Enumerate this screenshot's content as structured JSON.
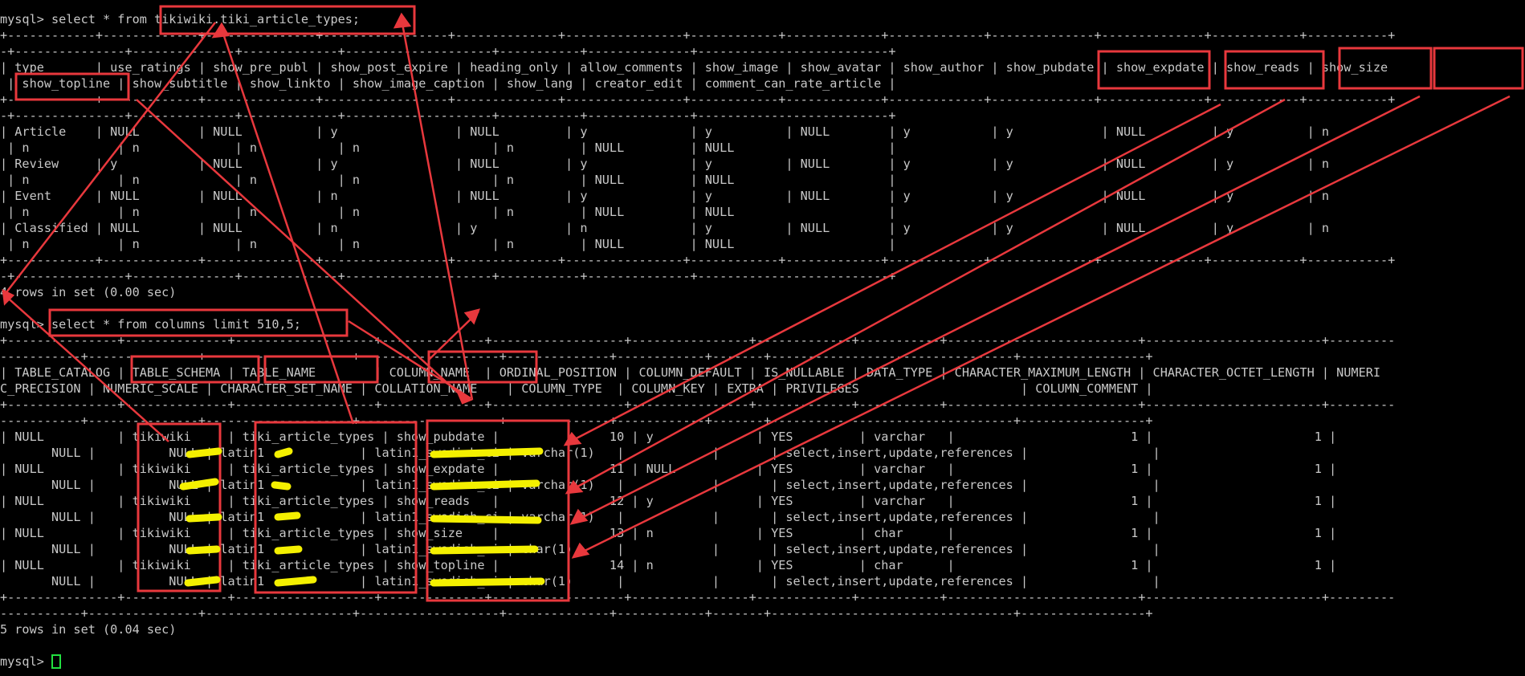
{
  "terminal": {
    "lines": [
      "mysql> select * from tikiwiki.tiki_article_types;",
      "+------------+-------------+---------------+-----------------+--------------+----------------+------------+-------------+-------------+--------------+--------------+------------+-----------+",
      "-+---------------+--------------+-------------+--------------------+-----------+--------------+--------------------------+",
      "| type       | use_ratings | show_pre_publ | show_post_expire | heading_only | allow_comments | show_image | show_avatar | show_author | show_pubdate | show_expdate | show_reads | show_size",
      " | show_topline | show_subtitle | show_linkto | show_image_caption | show_lang | creator_edit | comment_can_rate_article |",
      "+------------+-------------+---------------+-----------------+--------------+----------------+------------+-------------+-------------+--------------+--------------+------------+-----------+",
      "-+---------------+--------------+-------------+--------------------+-----------+--------------+--------------------------+",
      "| Article    | NULL        | NULL          | y                | NULL         | y              | y          | NULL        | y           | y            | NULL         | y          | n",
      " | n            | n             | n           | n                  | n         | NULL         | NULL                     |",
      "| Review     | y           | NULL          | y                | NULL         | y              | y          | NULL        | y           | y            | NULL         | y          | n",
      " | n            | n             | n           | n                  | n         | NULL         | NULL                     |",
      "| Event      | NULL        | NULL          | n                | NULL         | y              | y          | NULL        | y           | y            | NULL         | y          | n",
      " | n            | n             | n           | n                  | n         | NULL         | NULL                     |",
      "| Classified | NULL        | NULL          | n                | y            | n              | y          | NULL        | y           | y            | NULL         | y          | n",
      " | n            | n             | n           | n                  | n         | NULL         | NULL                     |",
      "+------------+-------------+---------------+-----------------+--------------+----------------+------------+-------------+-------------+--------------+--------------+------------+-----------+",
      "-+---------------+--------------+-------------+--------------------+-----------+--------------+--------------------------+",
      "4 rows in set (0.00 sec)",
      "",
      "mysql> select * from columns limit 510,5;",
      "+---------------+--------------+-------------------+--------------+------------------+----------------+-------------+-----------+--------------------------+------------------------+---------",
      "-----------+---------------+--------------------+-------------------+--------------+------------+-------+---------------------------------+-----------------+",
      "| TABLE_CATALOG | TABLE_SCHEMA | TABLE_NAME        | COLUMN_NAME  | ORDINAL_POSITION | COLUMN_DEFAULT | IS_NULLABLE | DATA_TYPE | CHARACTER_MAXIMUM_LENGTH | CHARACTER_OCTET_LENGTH | NUMERI",
      "C_PRECISION | NUMERIC_SCALE | CHARACTER_SET_NAME | COLLATION_NAME    | COLUMN_TYPE  | COLUMN_KEY | EXTRA | PRIVILEGES                      | COLUMN_COMMENT |",
      "+---------------+--------------+-------------------+--------------+------------------+----------------+-------------+-----------+--------------------------+------------------------+---------",
      "-----------+---------------+--------------------+-------------------+--------------+------------+-------+---------------------------------+-----------------+",
      "| NULL          | tikiwiki     | tiki_article_types | show_pubdate |               10 | y              | YES         | varchar   |                        1 |                      1 |",
      "       NULL |          NULL | latin1             | latin1_swedish_ci | varchar(1)   |            |       | select,insert,update,references |                 |",
      "| NULL          | tikiwiki     | tiki_article_types | show_expdate |               11 | NULL           | YES         | varchar   |                        1 |                      1 |",
      "       NULL |          NULL | latin1             | latin1_swedish_ci | varchar(1)   |            |       | select,insert,update,references |                 |",
      "| NULL          | tikiwiki     | tiki_article_types | show_reads   |               12 | y              | YES         | varchar   |                        1 |                      1 |",
      "       NULL |          NULL | latin1             | latin1_swedish_ci | varchar(1)   |            |       | select,insert,update,references |                 |",
      "| NULL          | tikiwiki     | tiki_article_types | show_size    |               13 | n              | YES         | char      |                        1 |                      1 |",
      "       NULL |          NULL | latin1             | latin1_swedish_ci | char(1)      |            |       | select,insert,update,references |                 |",
      "| NULL          | tikiwiki     | tiki_article_types | show_topline |               14 | n              | YES         | char      |                        1 |                      1 |",
      "       NULL |          NULL | latin1             | latin1_swedish_ci | char(1)      |            |       | select,insert,update,references |                 |",
      "+---------------+--------------+-------------------+--------------+------------------+----------------+-------------+-----------+--------------------------+------------------------+---------",
      "-----------+---------------+--------------------+-------------------+--------------+------------+-------+---------------------------------+-----------------+",
      "5 rows in set (0.04 sec)",
      ""
    ],
    "prompt": "mysql> ",
    "annotation_color": "#e8383d",
    "highlight_color": "#f4f000",
    "cursor_color": "#22e040"
  }
}
